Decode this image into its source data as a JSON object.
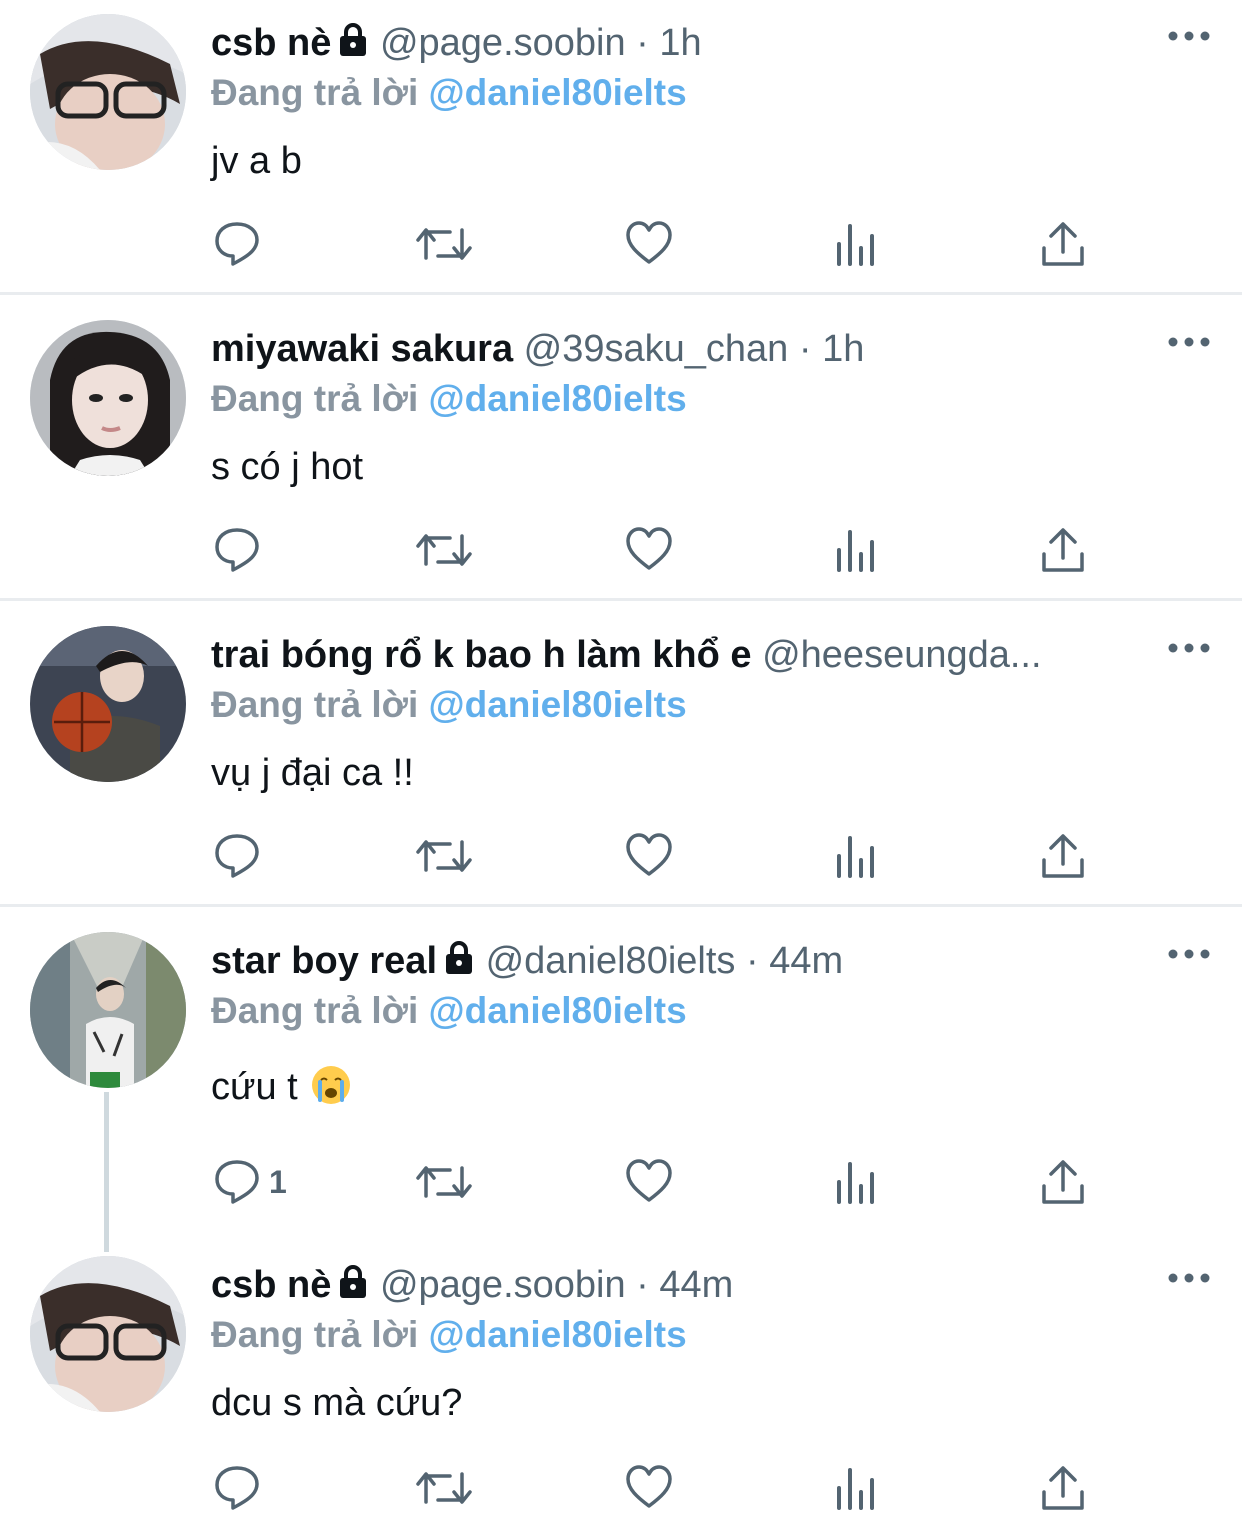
{
  "tweets": [
    {
      "name": "csb nè",
      "locked": true,
      "handle": "@page.soobin",
      "separator": "·",
      "time": "1h",
      "replying_prefix": "Đang trả lời",
      "replying_to": "@daniel80ielts",
      "text": "jv a b",
      "reply_count": ""
    },
    {
      "name": "miyawaki sakura",
      "locked": false,
      "handle": "@39saku_chan",
      "separator": "·",
      "time": "1h",
      "replying_prefix": "Đang trả lời",
      "replying_to": "@daniel80ielts",
      "text": "s có j hot",
      "reply_count": ""
    },
    {
      "name": "trai bóng rổ k bao h làm khổ e",
      "locked": false,
      "handle": "@heeseungda...",
      "separator": "",
      "time": "",
      "replying_prefix": "Đang trả lời",
      "replying_to": "@daniel80ielts",
      "text": "vụ j đại ca !!",
      "reply_count": ""
    },
    {
      "name": "star boy real",
      "locked": true,
      "handle": "@daniel80ielts",
      "separator": "·",
      "time": "44m",
      "replying_prefix": "Đang trả lời",
      "replying_to": "@daniel80ielts",
      "text": "cứu t",
      "emoji": "crying-face-emoji",
      "reply_count": "1"
    },
    {
      "name": "csb nè",
      "locked": true,
      "handle": "@page.soobin",
      "separator": "·",
      "time": "44m",
      "replying_prefix": "Đang trả lời",
      "replying_to": "@daniel80ielts",
      "text": "dcu s mà cứu?",
      "reply_count": ""
    }
  ],
  "icons": {
    "reply": "reply-icon",
    "retweet": "retweet-icon",
    "like": "heart-icon",
    "views": "views-icon",
    "share": "share-icon",
    "more": "more-icon",
    "lock": "lock-icon"
  },
  "colors": {
    "mention": "#3a9ce8",
    "muted": "#536471",
    "replying_label": "#8995a0",
    "divider": "#e9ecef",
    "thread_line": "#cfd9de"
  }
}
